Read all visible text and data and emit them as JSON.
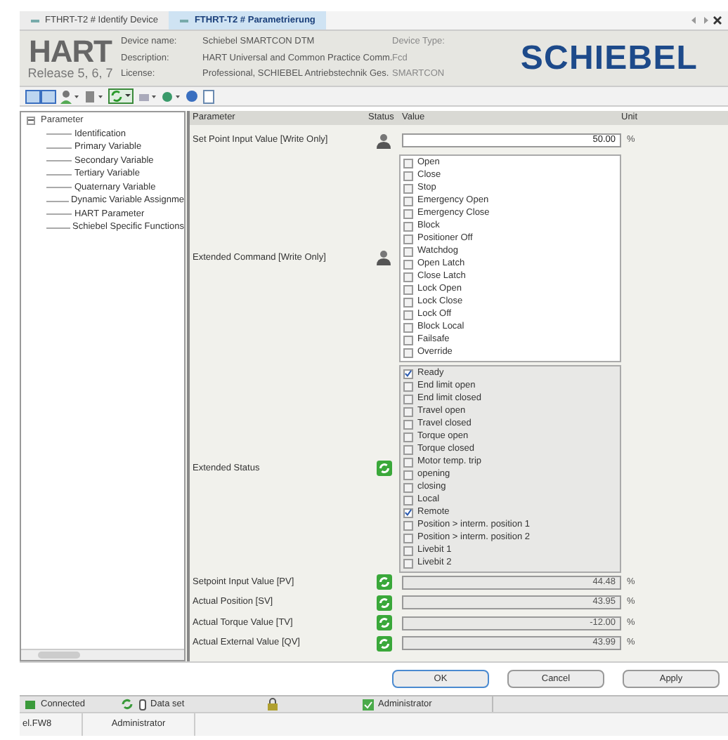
{
  "tabs": [
    {
      "label": "FTHRT-T2 # Identify Device",
      "selected": false
    },
    {
      "label": "FTHRT-T2 # Parametrierung",
      "selected": true
    }
  ],
  "header": {
    "logo": "HART",
    "release": "Release 5, 6, 7",
    "fields": [
      {
        "label": "Device name:",
        "value": "Schiebel SMARTCON DTM"
      },
      {
        "label": "Description:",
        "value": "HART Universal and Common Practice Comm."
      },
      {
        "label": "License:",
        "value": "Professional, SCHIEBEL Antriebstechnik Ges."
      }
    ],
    "device_type": {
      "label": "Device Type:",
      "values": [
        "Fcd",
        "SMARTCON"
      ]
    },
    "brand": "SCHIEBEL"
  },
  "tree": {
    "label": "Parameter",
    "expanded": true,
    "children": [
      {
        "label": "Identification"
      },
      {
        "label": "Primary Variable"
      },
      {
        "label": "Secondary Variable"
      },
      {
        "label": "Tertiary Variable"
      },
      {
        "label": "Quaternary Variable"
      },
      {
        "label": "Dynamic Variable Assignme"
      },
      {
        "label": "HART Parameter"
      },
      {
        "label": "Schiebel Specific Functions"
      }
    ]
  },
  "table": {
    "columns": [
      "Parameter",
      "Status",
      "Value",
      "Unit"
    ],
    "rows": [
      {
        "kind": "input",
        "parameter": "Set Point Input Value [Write Only]",
        "status": {
          "kind": "write"
        },
        "value": "50.00",
        "unit": "%"
      },
      {
        "kind": "checklist",
        "parameter": "Extended Command [Write Only]",
        "status": {
          "kind": "write"
        },
        "readonly": false,
        "items": [
          {
            "label": "Open",
            "checked": false
          },
          {
            "label": "Close",
            "checked": false
          },
          {
            "label": "Stop",
            "checked": false
          },
          {
            "label": "Emergency Open",
            "checked": false
          },
          {
            "label": "Emergency Close",
            "checked": false
          },
          {
            "label": "Block",
            "checked": false
          },
          {
            "label": "Positioner Off",
            "checked": false
          },
          {
            "label": "Watchdog",
            "checked": false
          },
          {
            "label": "Open Latch",
            "checked": false
          },
          {
            "label": "Close Latch",
            "checked": false
          },
          {
            "label": "Lock Open",
            "checked": false
          },
          {
            "label": "Lock Close",
            "checked": false
          },
          {
            "label": "Lock Off",
            "checked": false
          },
          {
            "label": "Block Local",
            "checked": false
          },
          {
            "label": "Failsafe",
            "checked": false
          },
          {
            "label": "Override",
            "checked": false
          }
        ]
      },
      {
        "kind": "checklist",
        "parameter": "Extended Status",
        "status": {
          "kind": "refresh"
        },
        "readonly": true,
        "items": [
          {
            "label": "Ready",
            "checked": true
          },
          {
            "label": "End limit open",
            "checked": false
          },
          {
            "label": "End limit closed",
            "checked": false
          },
          {
            "label": "Travel open",
            "checked": false
          },
          {
            "label": "Travel closed",
            "checked": false
          },
          {
            "label": "Torque open",
            "checked": false
          },
          {
            "label": "Torque closed",
            "checked": false
          },
          {
            "label": "Motor temp. trip",
            "checked": false
          },
          {
            "label": "opening",
            "checked": false
          },
          {
            "label": "closing",
            "checked": false
          },
          {
            "label": "Local",
            "checked": false
          },
          {
            "label": "Remote",
            "checked": true
          },
          {
            "label": "Position > interm. position 1",
            "checked": false
          },
          {
            "label": "Position > interm. position 2",
            "checked": false
          },
          {
            "label": "Livebit 1",
            "checked": false
          },
          {
            "label": "Livebit 2",
            "checked": false
          }
        ]
      },
      {
        "kind": "readonly",
        "parameter": "Setpoint Input Value [PV]",
        "status": {
          "kind": "refresh"
        },
        "value": "44.48",
        "unit": "%"
      },
      {
        "kind": "readonly",
        "parameter": "Actual Position [SV]",
        "status": {
          "kind": "refresh"
        },
        "value": "43.95",
        "unit": "%"
      },
      {
        "kind": "readonly",
        "parameter": "Actual Torque Value [TV]",
        "status": {
          "kind": "refresh"
        },
        "value": "-12.00",
        "unit": "%"
      },
      {
        "kind": "readonly",
        "parameter": "Actual External Value [QV]",
        "status": {
          "kind": "refresh"
        },
        "value": "43.99",
        "unit": "%"
      }
    ]
  },
  "buttons": [
    {
      "label": "OK",
      "default": true
    },
    {
      "label": "Cancel",
      "default": false
    },
    {
      "label": "Apply",
      "default": false
    }
  ],
  "status_bar": [
    {
      "kind": "connected",
      "label": "Connected"
    },
    {
      "kind": "dataset",
      "label": "Data set"
    },
    {
      "kind": "lock"
    },
    {
      "kind": "user",
      "label": "Administrator"
    }
  ],
  "bottom_bar": [
    "el.FW8",
    "Administrator"
  ]
}
